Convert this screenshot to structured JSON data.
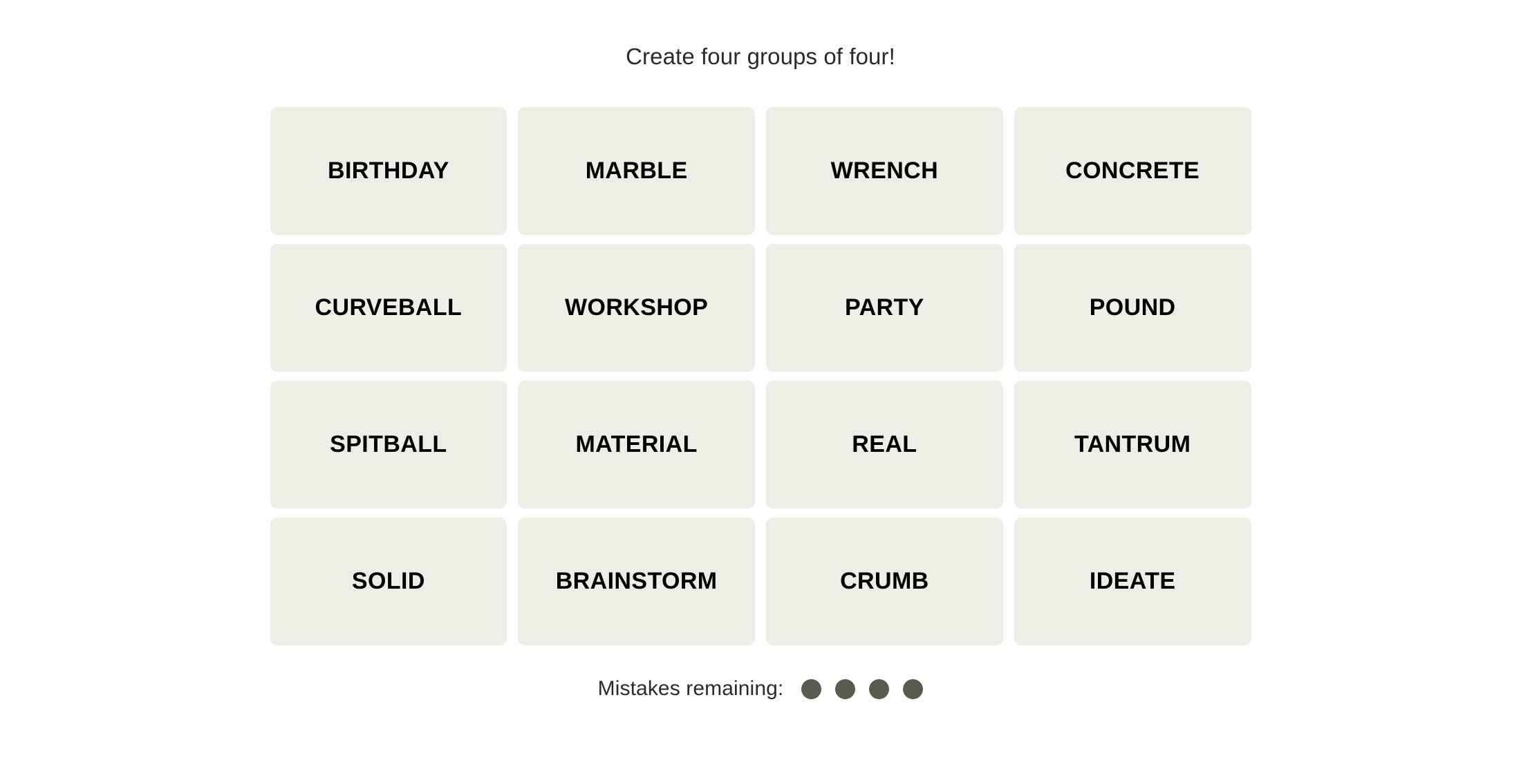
{
  "header": {
    "instruction": "Create four groups of four!"
  },
  "board": {
    "rows": 4,
    "columns": 4,
    "tile_background_color": "#EEEEE6",
    "tile_text_color": "#000000",
    "tiles": [
      {
        "label": "BIRTHDAY"
      },
      {
        "label": "MARBLE"
      },
      {
        "label": "WRENCH"
      },
      {
        "label": "CONCRETE"
      },
      {
        "label": "CURVEBALL"
      },
      {
        "label": "WORKSHOP"
      },
      {
        "label": "PARTY"
      },
      {
        "label": "POUND"
      },
      {
        "label": "SPITBALL"
      },
      {
        "label": "MATERIAL"
      },
      {
        "label": "REAL"
      },
      {
        "label": "TANTRUM"
      },
      {
        "label": "SOLID"
      },
      {
        "label": "BRAINSTORM"
      },
      {
        "label": "CRUMB"
      },
      {
        "label": "IDEATE"
      }
    ]
  },
  "footer": {
    "mistakes_label": "Mistakes remaining:",
    "mistakes_remaining": 4,
    "dot_color": "#5A5A4E",
    "dots": [
      {
        "name": "mistake-dot-1"
      },
      {
        "name": "mistake-dot-2"
      },
      {
        "name": "mistake-dot-3"
      },
      {
        "name": "mistake-dot-4"
      }
    ]
  },
  "theme": {
    "page_background": "#FFFFFF",
    "text_color": "#2B2B2B"
  }
}
